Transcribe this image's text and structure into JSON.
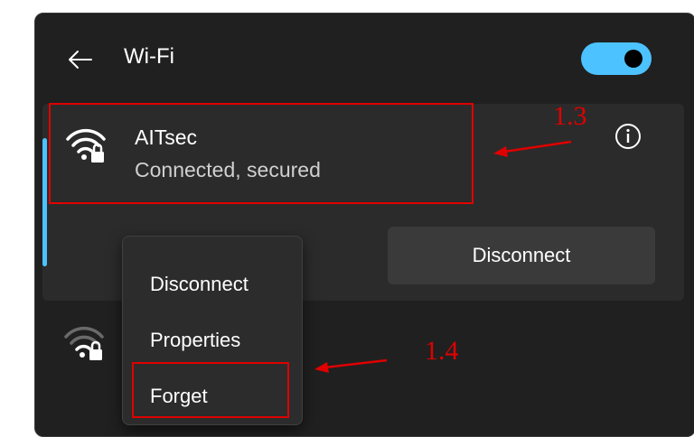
{
  "header": {
    "title": "Wi-Fi",
    "toggle_state": "on"
  },
  "connected_network": {
    "name": "AITsec",
    "status": "Connected, secured",
    "disconnect_label": "Disconnect"
  },
  "context_menu": {
    "items": [
      "Disconnect",
      "Properties",
      "Forget"
    ]
  },
  "annotations": {
    "step_a": "1.3",
    "step_b": "1.4"
  },
  "colors": {
    "accent": "#4cc2ff",
    "panel_bg": "#202020",
    "card_bg": "#2b2b2b",
    "highlight_red": "#e00000"
  },
  "icons": [
    "back-arrow",
    "wifi-secured",
    "info",
    "wifi-secured-dim"
  ]
}
